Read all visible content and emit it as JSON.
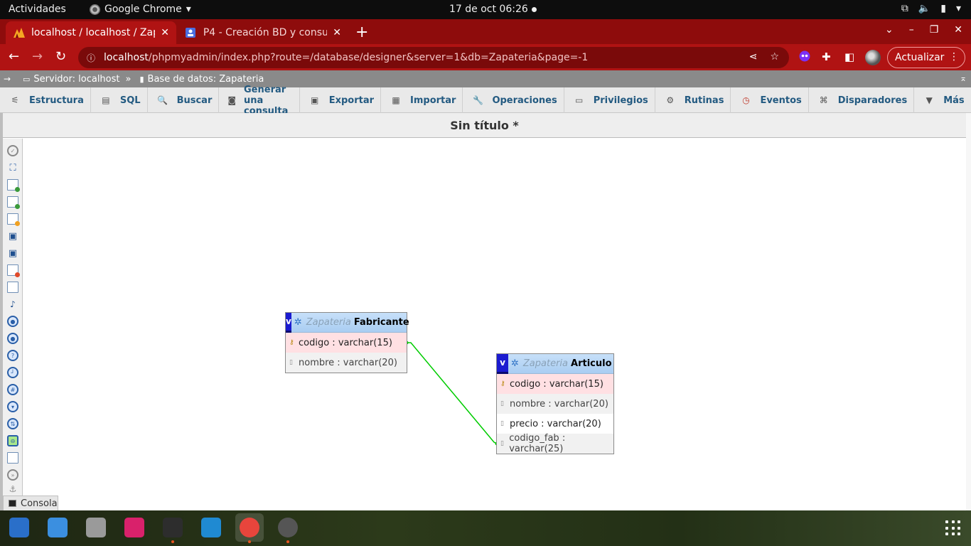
{
  "system_bar": {
    "activities": "Actividades",
    "app_name": "Google Chrome",
    "clock": "17 de oct  06:26"
  },
  "browser": {
    "tabs": [
      {
        "title": "localhost / localhost / Zap",
        "icon": "phpmyadmin-icon",
        "active": true
      },
      {
        "title": "P4 - Creación BD y consult",
        "icon": "form-icon",
        "active": false
      }
    ],
    "url_host": "localhost",
    "url_path": "/phpmyadmin/index.php?route=/database/designer&server=1&db=Zapateria&page=-1",
    "update_label": "Actualizar",
    "theme_color": "#b01313"
  },
  "pma": {
    "breadcrumb": {
      "server_label": "Servidor: localhost",
      "separator": "»",
      "database_label": "Base de datos: Zapateria"
    },
    "menu": [
      {
        "label": "Estructura",
        "icon": "structure-icon"
      },
      {
        "label": "SQL",
        "icon": "sql-icon"
      },
      {
        "label": "Buscar",
        "icon": "search-icon"
      },
      {
        "label": "Generar una consulta",
        "icon": "query-icon"
      },
      {
        "label": "Exportar",
        "icon": "export-icon"
      },
      {
        "label": "Importar",
        "icon": "import-icon"
      },
      {
        "label": "Operaciones",
        "icon": "wrench-icon"
      },
      {
        "label": "Privilegios",
        "icon": "privileges-icon"
      },
      {
        "label": "Rutinas",
        "icon": "routines-icon"
      },
      {
        "label": "Eventos",
        "icon": "clock-icon"
      },
      {
        "label": "Disparadores",
        "icon": "triggers-icon"
      },
      {
        "label": "Más",
        "icon": "caret-down-icon"
      }
    ],
    "designer_title": "Sin título *",
    "console_label": "Consola",
    "tables": [
      {
        "db": "Zapateria",
        "name": "Fabricante",
        "fields": [
          {
            "label": "codigo : varchar(15)",
            "primary": true
          },
          {
            "label": "nombre : varchar(20)",
            "primary": false
          }
        ]
      },
      {
        "db": "Zapateria",
        "name": "Articulo",
        "fields": [
          {
            "label": "codigo : varchar(15)",
            "primary": true
          },
          {
            "label": "nombre : varchar(20)",
            "primary": false
          },
          {
            "label": "precio : varchar(20)",
            "primary": false
          },
          {
            "label": "codigo_fab : varchar(25)",
            "primary": false
          }
        ]
      }
    ],
    "relation": {
      "from": "Fabricante.codigo",
      "to": "Articulo.codigo_fab",
      "color": "#00cc00"
    }
  },
  "dock": [
    {
      "name": "writer",
      "color": "#2a6fc9"
    },
    {
      "name": "system-monitor",
      "color": "#3b8fe0"
    },
    {
      "name": "files",
      "color": "#9a9a9a"
    },
    {
      "name": "screenshot",
      "color": "#d9216b"
    },
    {
      "name": "terminal",
      "color": "#2d2d2d"
    },
    {
      "name": "vscode",
      "color": "#1f8ad2"
    },
    {
      "name": "chrome",
      "color": "#e8453c"
    },
    {
      "name": "software-updater",
      "color": "#555555"
    }
  ]
}
